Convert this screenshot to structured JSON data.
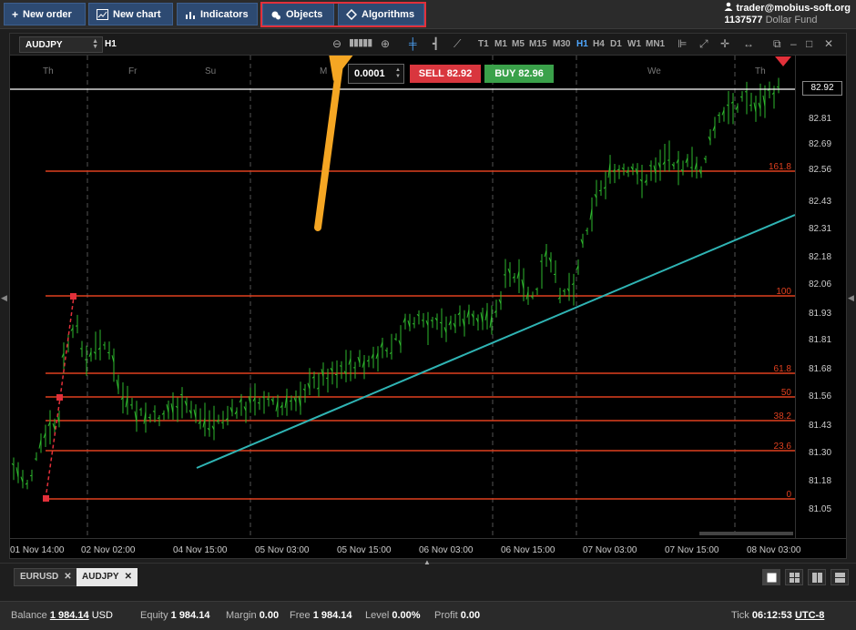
{
  "toolbar": {
    "new_order": "New order",
    "new_chart": "New chart",
    "indicators": "Indicators",
    "objects": "Objects",
    "algorithms": "Algorithms"
  },
  "account": {
    "user": "trader@mobius-soft.org",
    "number": "1137577",
    "fund": "Dollar Fund"
  },
  "chart": {
    "symbol": "AUDJPY",
    "timeframe": "H1",
    "timeframes": [
      "T1",
      "M1",
      "M5",
      "M15",
      "M30",
      "H1",
      "H4",
      "D1",
      "W1",
      "MN1"
    ],
    "active_timeframe": "H1",
    "lot": "0.0001",
    "sell_label": "SELL",
    "sell_price": "82.92",
    "buy_label": "BUY",
    "buy_price": "82.96",
    "current_price": "82.92",
    "y_labels": [
      "82.81",
      "82.69",
      "82.56",
      "82.43",
      "82.31",
      "82.18",
      "82.06",
      "81.93",
      "81.81",
      "81.68",
      "81.56",
      "81.43",
      "81.30",
      "81.18",
      "81.05"
    ],
    "x_labels": [
      "01 Nov 14:00",
      "02 Nov 02:00",
      "04 Nov 15:00",
      "05 Nov 03:00",
      "05 Nov 15:00",
      "06 Nov 03:00",
      "06 Nov 15:00",
      "07 Nov 03:00",
      "07 Nov 15:00",
      "08 Nov 03:00"
    ],
    "day_labels": [
      "Th",
      "Fr",
      "Su",
      "M",
      "We",
      "Th"
    ],
    "fib_levels": [
      {
        "label": "161.8",
        "price": 82.55
      },
      {
        "label": "100",
        "price": 81.98
      },
      {
        "label": "61.8",
        "price": 81.63
      },
      {
        "label": "50",
        "price": 81.53
      },
      {
        "label": "38.2",
        "price": 81.42
      },
      {
        "label": "23.6",
        "price": 81.29
      },
      {
        "label": "0",
        "price": 81.07
      }
    ],
    "colors": {
      "fib": "#e0401f",
      "trendline": "#2fb4b4",
      "candle": "#2eb82e",
      "current_line": "#ffffff",
      "annotation_arrow": "#f5a623",
      "highlight": "#e2303a"
    }
  },
  "tabs": [
    {
      "label": "EURUSD",
      "active": false
    },
    {
      "label": "AUDJPY",
      "active": true
    }
  ],
  "status": {
    "balance_label": "Balance",
    "balance": "1 984.14",
    "balance_ccy": "USD",
    "equity_label": "Equity",
    "equity": "1 984.14",
    "margin_label": "Margin",
    "margin": "0.00",
    "free_label": "Free",
    "free": "1 984.14",
    "level_label": "Level",
    "level": "0.00%",
    "profit_label": "Profit",
    "profit": "0.00",
    "tick_label": "Tick",
    "time": "06:12:53",
    "timezone": "UTC-8"
  }
}
